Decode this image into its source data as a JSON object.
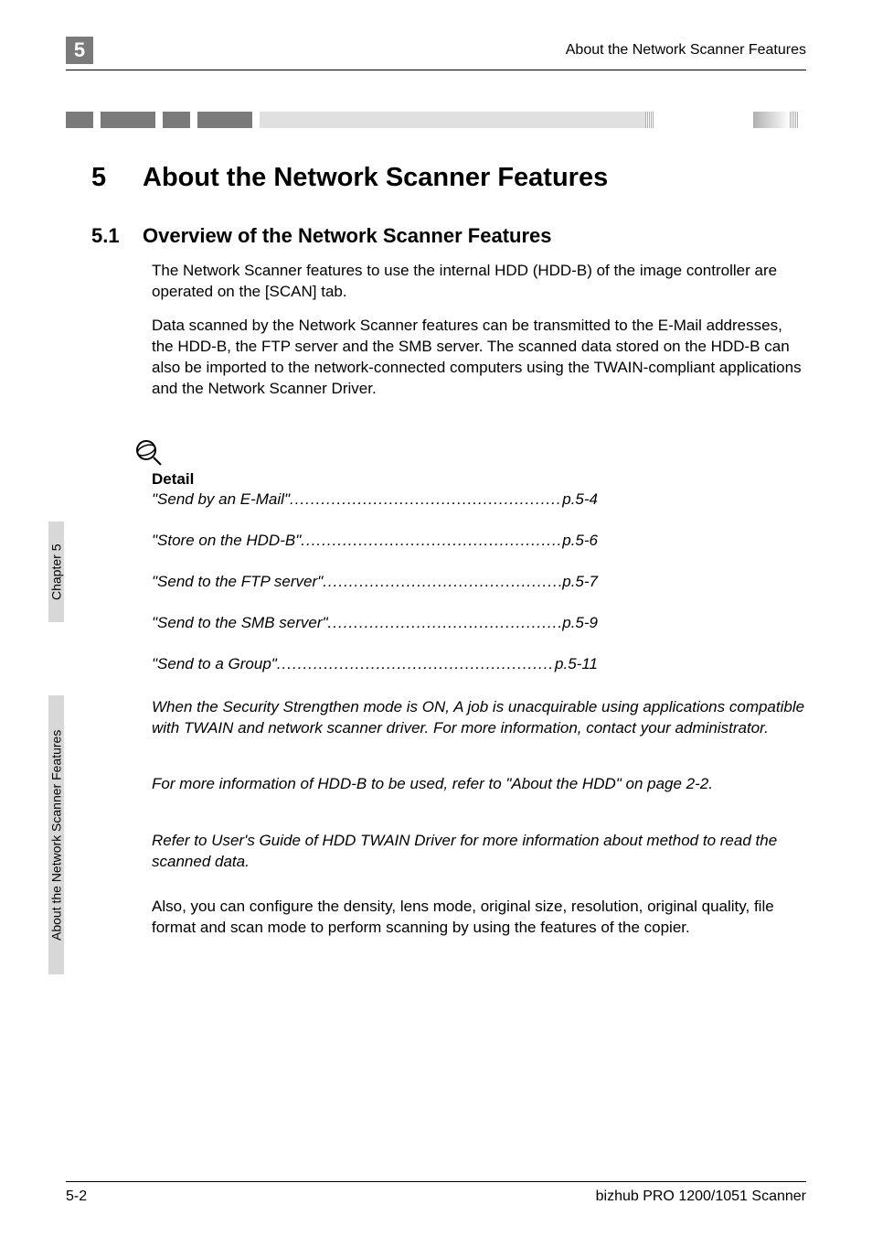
{
  "header": {
    "page_number_box": "5",
    "running_header": "About the Network Scanner Features"
  },
  "chapter": {
    "number": "5",
    "title": "About the Network Scanner Features"
  },
  "section": {
    "number": "5.1",
    "title": "Overview of the Network Scanner Features"
  },
  "paragraphs": {
    "p1": "The Network Scanner features to use the internal HDD (HDD-B) of the image controller are operated on the [SCAN] tab.",
    "p2": "Data scanned by the Network Scanner features can be transmitted to the E-Mail addresses, the HDD-B, the FTP server and the SMB server. The scanned data stored on the HDD-B can also be imported to the network-connected computers using the TWAIN-compliant applications and the Network Scanner Driver.",
    "p3": "Also, you can configure the density, lens mode, original size, resolution, original quality, file format and scan mode to perform scanning by using the features of the copier."
  },
  "detail_label": "Detail",
  "detail_items": [
    {
      "label": "\"Send by an E-Mail\"",
      "page": "p.5-4"
    },
    {
      "label": "\"Store on the HDD-B\"",
      "page": "p.5-6"
    },
    {
      "label": "\"Send to the FTP server\"",
      "page": "p.5-7"
    },
    {
      "label": "\"Send to the SMB server\"",
      "page": "p.5-9"
    },
    {
      "label": "\"Send to a Group\"",
      "page": "p.5-11"
    }
  ],
  "italic_paragraphs": {
    "ip1": "When the Security Strengthen mode is ON, A job is unacquirable using applications compatible with TWAIN and network scanner driver. For more information, contact your administrator.",
    "ip2": "For more information of HDD-B to be used, refer to \"About the HDD\" on page 2-2.",
    "ip3": "Refer to User's Guide of HDD TWAIN Driver for more information about method to read the scanned data."
  },
  "vertical_tabs": {
    "vt1": "Chapter 5",
    "vt2": "About the Network Scanner Features"
  },
  "footer": {
    "left": "5-2",
    "right": "bizhub PRO 1200/1051 Scanner"
  }
}
